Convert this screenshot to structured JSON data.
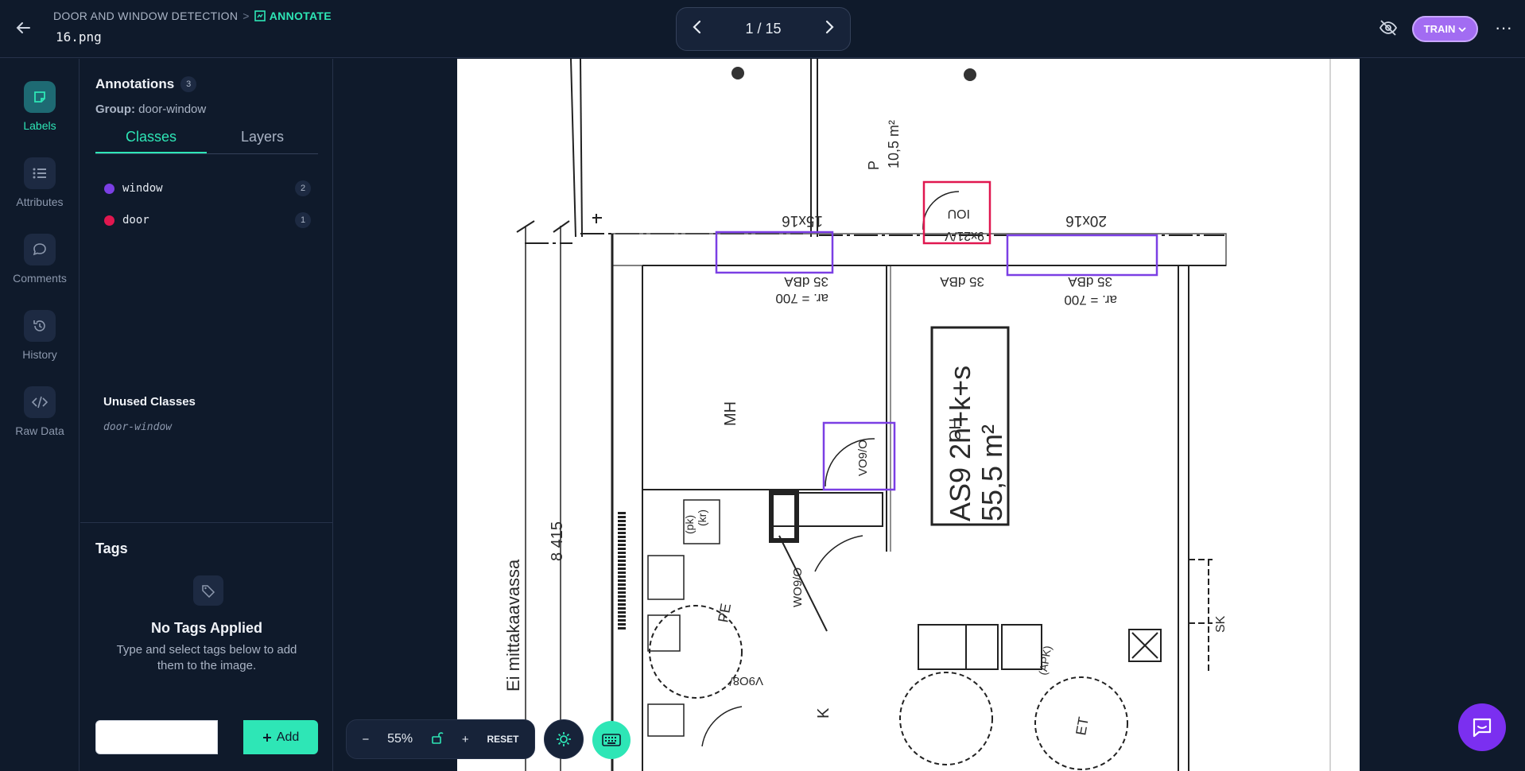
{
  "header": {
    "breadcrumb_project": "DOOR AND WINDOW DETECTION",
    "breadcrumb_separator": ">",
    "breadcrumb_mode": "ANNOTATE",
    "file_name": "16.png",
    "pager": "1 / 15",
    "train_label": "TRAIN",
    "more": "···"
  },
  "rail": [
    {
      "label": "Labels",
      "icon": "labels-icon"
    },
    {
      "label": "Attributes",
      "icon": "attributes-icon"
    },
    {
      "label": "Comments",
      "icon": "comments-icon"
    },
    {
      "label": "History",
      "icon": "history-icon"
    },
    {
      "label": "Raw Data",
      "icon": "code-icon"
    }
  ],
  "panel": {
    "title": "Annotations",
    "count": "3",
    "group_label": "Group:",
    "group_value": "door-window",
    "tabs": [
      "Classes",
      "Layers"
    ],
    "classes": [
      {
        "name": "window",
        "count": "2",
        "color": "#7b3fe4"
      },
      {
        "name": "door",
        "count": "1",
        "color": "#e0174f"
      }
    ],
    "unused_title": "Unused Classes",
    "unused_items": [
      "door-window"
    ]
  },
  "tags": {
    "title": "Tags",
    "empty_title": "No Tags Applied",
    "empty_desc": "Type and select tags below to add them to the image.",
    "input_value": "",
    "add_label": "Add"
  },
  "toolbar": {
    "zoom_out": "−",
    "zoom": "55%",
    "zoom_in": "+",
    "reset": "RESET"
  },
  "plan_text": {
    "room_p": "P",
    "area_p": "10,5 m²",
    "win1": "15x16",
    "win2": "20x16",
    "door_label": "9x21/V",
    "iou": "IOU",
    "db1": "35 dBA",
    "db2": "35 dBA",
    "db3": "35 dBA",
    "ar1": "ar. = 700",
    "ar2": "ar. = 700",
    "mh": "MH",
    "oh": "OH",
    "apt": "AS9 2h+k+s",
    "apt_area": "55,5 m²",
    "vo9": "VO9/O",
    "wo9": "WO9/O",
    "v9o8": "V9O8/",
    "k": "K",
    "kr": "(kr)",
    "pk": "(pk)",
    "pe": "PE",
    "dim": "8 415",
    "ei": "Ei mittakaavassa",
    "apk": "(APK)",
    "et": "ET",
    "sk": "SK"
  },
  "colors": {
    "accent": "#2ee6b6",
    "window": "#7b3fe4",
    "door": "#e0174f",
    "train": "#a26cf2"
  }
}
